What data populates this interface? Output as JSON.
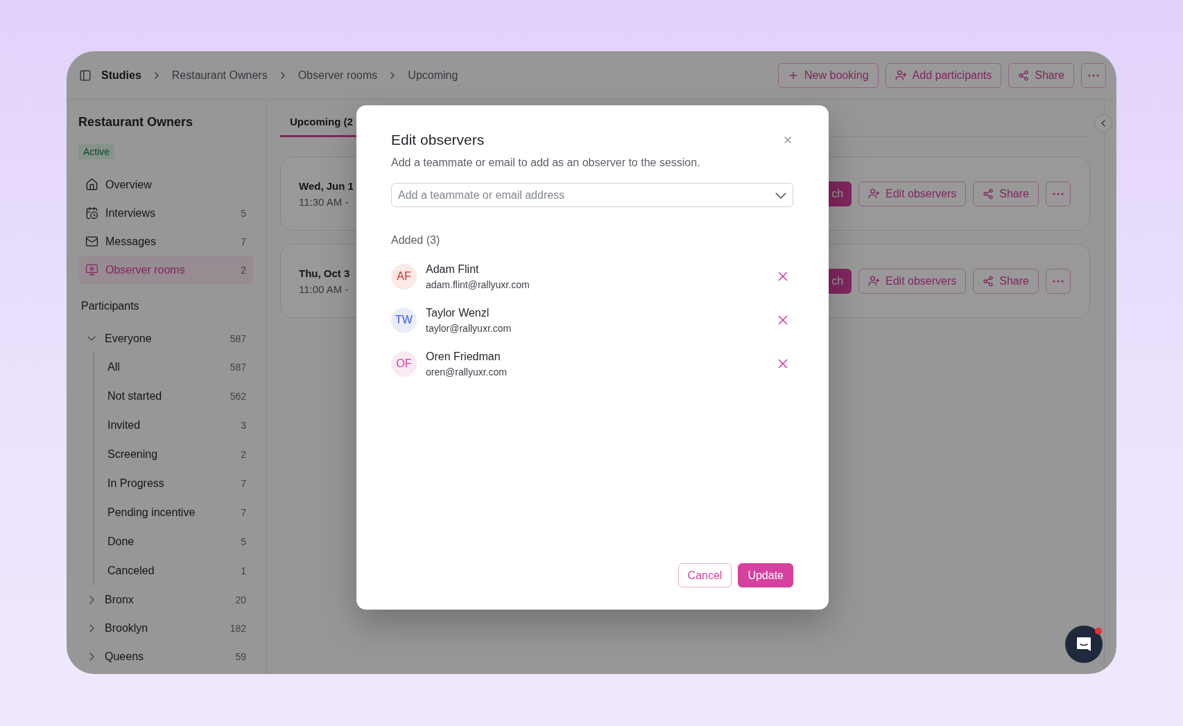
{
  "breadcrumbs": [
    {
      "label": "Studies"
    },
    {
      "label": "Restaurant Owners"
    },
    {
      "label": "Observer rooms"
    },
    {
      "label": "Upcoming"
    }
  ],
  "header_actions": [
    {
      "kind": "plus",
      "label": "New booking"
    },
    {
      "kind": "user-add",
      "label": "Add participants"
    },
    {
      "kind": "share",
      "label": "Share"
    },
    {
      "kind": "more"
    }
  ],
  "sidebar": {
    "title": "Restaurant Owners",
    "status": "Active",
    "nav": [
      {
        "kind": "home",
        "label": "Overview",
        "selected": false
      },
      {
        "kind": "calendar",
        "label": "Interviews",
        "count": "5",
        "selected": false
      },
      {
        "kind": "mail",
        "label": "Messages",
        "count": "7",
        "selected": false
      },
      {
        "kind": "monitor",
        "label": "Observer rooms",
        "count": "2",
        "selected": true
      }
    ],
    "section_title": "Participants",
    "groups": [
      {
        "label": "Everyone",
        "count": "587",
        "expanded": true,
        "children": [
          {
            "label": "All",
            "count": "587"
          },
          {
            "label": "Not started",
            "count": "562"
          },
          {
            "label": "Invited",
            "count": "3"
          },
          {
            "label": "Screening",
            "count": "2"
          },
          {
            "label": "In Progress",
            "count": "7"
          },
          {
            "label": "Pending incentive",
            "count": "7"
          },
          {
            "label": "Done",
            "count": "5"
          },
          {
            "label": "Canceled",
            "count": "1"
          }
        ]
      },
      {
        "label": "Bronx",
        "count": "20",
        "expanded": false
      },
      {
        "label": "Brooklyn",
        "count": "182",
        "expanded": false
      },
      {
        "label": "Queens",
        "count": "59",
        "expanded": false
      }
    ]
  },
  "tabs": [
    {
      "label": "Upcoming (2",
      "selected": true
    }
  ],
  "sessions": [
    {
      "date": "Wed, Jun 1",
      "time": "11:30 AM -",
      "actions": [
        {
          "kind": "primary",
          "label": "ch"
        },
        {
          "kind": "observers",
          "label": "Edit observers"
        },
        {
          "kind": "share",
          "label": "Share"
        },
        {
          "kind": "more"
        }
      ]
    },
    {
      "date": "Thu, Oct 3",
      "time": "11:00 AM -",
      "actions": [
        {
          "kind": "primary",
          "label": "ch"
        },
        {
          "kind": "observers",
          "label": "Edit observers"
        },
        {
          "kind": "share",
          "label": "Share"
        },
        {
          "kind": "more"
        }
      ]
    }
  ],
  "modal": {
    "title": "Edit observers",
    "subtitle": "Add a teammate or email to add as an observer to the session.",
    "select": {
      "placeholder": "Add a teammate or email address"
    },
    "added_label": "Added (3)",
    "observers": [
      {
        "initials": "AF",
        "name": "Adam Flint",
        "email": "adam.flint@rallyuxr.com",
        "color": "#d92d20"
      },
      {
        "initials": "TW",
        "name": "Taylor Wenzl",
        "email": "taylor@rallyuxr.com",
        "color": "#3b5bdb"
      },
      {
        "initials": "OF",
        "name": "Oren Friedman",
        "email": "oren@rallyuxr.com",
        "color": "#d6409f"
      }
    ],
    "buttons": [
      {
        "kind": "secondary",
        "label": "Cancel"
      },
      {
        "kind": "primary",
        "label": "Update"
      }
    ]
  },
  "chat": {
    "unread": true
  }
}
